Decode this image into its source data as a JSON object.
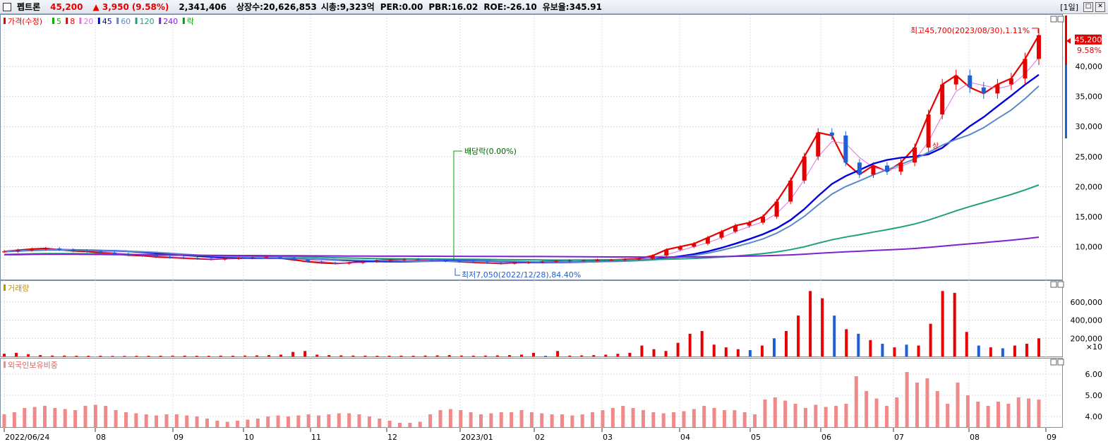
{
  "header": {
    "name": "펩트론",
    "price": "45,200",
    "change": "▲ 3,950",
    "change_pct": "(9.58%)",
    "volume": "2,341,406",
    "listed": "상장수:20,626,853",
    "mcap": "시총:9,323억",
    "per": "PER:0.00",
    "pbr": "PBR:16.02",
    "roe": "ROE:-26.10",
    "float": "유보율:345.91",
    "period": "[1일]"
  },
  "colors": {
    "up": "#e60000",
    "down": "#1f5fd6",
    "ma5": "#00b400",
    "ma8": "#e60000",
    "ma20": "#e070e0",
    "ma45": "#0000e0",
    "ma60": "#5a8ac8",
    "ma120": "#20a080",
    "ma240": "#8020d0",
    "foreign": "#f08a8a"
  },
  "legend": {
    "price": [
      {
        "label": "가격(수정)",
        "color": "#e60000"
      },
      {
        "label": "5",
        "color": "#00b400"
      },
      {
        "label": "8",
        "color": "#e60000"
      },
      {
        "label": "20",
        "color": "#e070e0"
      },
      {
        "label": "45",
        "color": "#0000e0"
      },
      {
        "label": "60",
        "color": "#5a8ac8"
      },
      {
        "label": "120",
        "color": "#20a080"
      },
      {
        "label": "240",
        "color": "#8020d0"
      },
      {
        "label": "락",
        "color": "#00a000"
      }
    ],
    "volume": "거래량",
    "foreign": "외국인보유비중"
  },
  "annotations": {
    "high": "최고45,700(2023/08/30),1.11%",
    "low": "최저7,050(2022/12/28),84.40%",
    "dividend": "배당락(0.00%)",
    "surge": "상",
    "last_price": "45,200",
    "last_pct": "9.58%"
  },
  "chart_data": [
    {
      "type": "candlestick",
      "title": "가격(수정)",
      "x": [
        "2022/06/24",
        "08",
        "09",
        "10",
        "11",
        "12",
        "2023/01",
        "02",
        "03",
        "04",
        "05",
        "06",
        "07",
        "08",
        "09"
      ],
      "y_ticks": [
        "10,000",
        "15,000",
        "20,000",
        "25,000",
        "30,000",
        "35,000",
        "40,000"
      ],
      "ylim": [
        5000,
        48000
      ],
      "close": [
        9200,
        9400,
        9600,
        9700,
        9500,
        9300,
        9200,
        9000,
        8800,
        8600,
        8500,
        8300,
        8200,
        8100,
        8000,
        7900,
        8000,
        8100,
        8200,
        8300,
        8100,
        7800,
        7500,
        7300,
        7200,
        7300,
        7500,
        7700,
        7800,
        7900,
        7800,
        7700,
        7600,
        7500,
        7400,
        7300,
        7200,
        7300,
        7400,
        7500,
        7600,
        7700,
        7700,
        7800,
        7800,
        7900,
        8000,
        8500,
        9500,
        10000,
        10500,
        11500,
        12500,
        13500,
        14000,
        15000,
        17500,
        21000,
        25000,
        29000,
        28500,
        24000,
        22000,
        23500,
        22500,
        24000,
        26500,
        32000,
        37000,
        38500,
        36500,
        35500,
        37000,
        38000,
        41250,
        45200
      ],
      "ma_periods": [
        5,
        8,
        20,
        45,
        60,
        120,
        240
      ],
      "high": 45700,
      "low": 7050
    },
    {
      "type": "bar",
      "title": "거래량",
      "y_ticks": [
        "200,000",
        "400,000",
        "600,000"
      ],
      "unit": "×10",
      "ylim": [
        0,
        800000
      ],
      "values": [
        30000,
        40000,
        25000,
        15000,
        10000,
        10000,
        8000,
        8000,
        8000,
        6000,
        6000,
        7000,
        8000,
        8000,
        9000,
        9000,
        8000,
        8000,
        9000,
        8000,
        10000,
        12000,
        15000,
        20000,
        50000,
        60000,
        20000,
        15000,
        12000,
        10000,
        9000,
        8000,
        9000,
        9000,
        8000,
        10000,
        12000,
        15000,
        10000,
        9000,
        10000,
        12000,
        15000,
        20000,
        40000,
        8000,
        60000,
        10000,
        12000,
        15000,
        20000,
        30000,
        40000,
        120000,
        80000,
        60000,
        150000,
        250000,
        280000,
        130000,
        100000,
        80000,
        70000,
        120000,
        200000,
        280000,
        450000,
        720000,
        640000,
        450000,
        300000,
        250000,
        180000,
        140000,
        100000,
        130000,
        120000,
        360000,
        720000,
        700000,
        270000,
        120000,
        100000,
        90000,
        120000,
        140000,
        200000
      ],
      "colors_up": [
        true,
        true,
        true,
        true,
        true,
        true,
        true,
        true,
        true,
        true,
        true,
        true,
        true,
        true,
        true,
        true,
        true,
        true,
        true,
        true,
        true,
        true,
        true,
        true,
        true,
        true,
        true,
        true,
        true,
        true,
        true,
        true,
        true,
        true,
        true,
        true,
        true,
        true,
        true,
        true,
        true,
        true,
        true,
        true,
        true,
        false,
        true,
        true,
        true,
        true,
        true,
        true,
        true,
        true,
        true,
        true,
        true,
        true,
        true,
        true,
        true,
        true,
        false,
        true,
        false,
        true,
        true,
        true,
        true,
        false,
        true,
        false,
        true,
        false,
        true,
        false,
        true,
        true,
        true,
        true,
        true,
        false,
        true,
        false,
        true,
        true,
        true
      ]
    },
    {
      "type": "bar",
      "title": "외국인보유비중",
      "y_ticks": [
        "4.00",
        "5.00",
        "6.00"
      ],
      "ylim": [
        3.5,
        6.5
      ],
      "values": [
        4.1,
        4.2,
        4.4,
        4.45,
        4.5,
        4.4,
        4.35,
        4.3,
        4.5,
        4.55,
        4.5,
        4.3,
        4.2,
        4.15,
        4.1,
        4.05,
        4.1,
        4.1,
        4.05,
        4.0,
        3.9,
        3.8,
        3.75,
        3.8,
        3.85,
        3.9,
        4.0,
        4.05,
        4.0,
        4.05,
        4.1,
        4.05,
        4.1,
        4.15,
        4.15,
        4.1,
        4.0,
        3.9,
        3.8,
        3.7,
        3.7,
        3.75,
        4.1,
        4.3,
        4.35,
        4.3,
        4.2,
        4.1,
        4.15,
        4.2,
        4.2,
        4.3,
        4.2,
        4.15,
        4.1,
        4.1,
        4.05,
        4.1,
        4.2,
        4.3,
        4.4,
        4.5,
        4.4,
        4.3,
        4.2,
        4.15,
        4.2,
        4.25,
        4.35,
        4.5,
        4.4,
        4.3,
        4.3,
        4.2,
        4.1,
        4.8,
        4.9,
        4.75,
        4.6,
        4.4,
        4.55,
        4.45,
        4.5,
        4.6,
        5.9,
        5.2,
        4.85,
        4.5,
        4.9,
        6.1,
        5.6,
        5.8,
        5.2,
        4.6,
        5.6,
        5.0,
        4.7,
        4.5,
        4.7,
        4.6,
        4.9,
        4.85,
        4.8
      ]
    }
  ]
}
